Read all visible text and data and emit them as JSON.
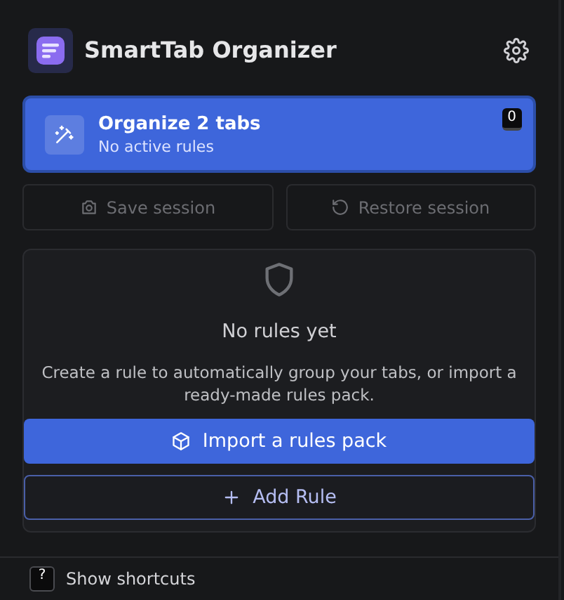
{
  "header": {
    "title": "SmartTab Organizer"
  },
  "organize": {
    "title": "Organize 2 tabs",
    "subtitle": "No active rules",
    "shortcut_key": "0"
  },
  "session_buttons": [
    {
      "label": "Save session",
      "kind": "save",
      "disabled": true
    },
    {
      "label": "Restore session",
      "kind": "restore",
      "disabled": true
    }
  ],
  "rules": {
    "empty_title": "No rules yet",
    "empty_text": "Create a rule to automatically group your tabs, or import a ready-made rules pack.",
    "actions": [
      {
        "label": "Import a rules pack",
        "kind": "primary"
      },
      {
        "label": "Add Rule",
        "kind": "outline"
      }
    ]
  },
  "footer": {
    "key": "?",
    "label": "Show shortcuts"
  }
}
